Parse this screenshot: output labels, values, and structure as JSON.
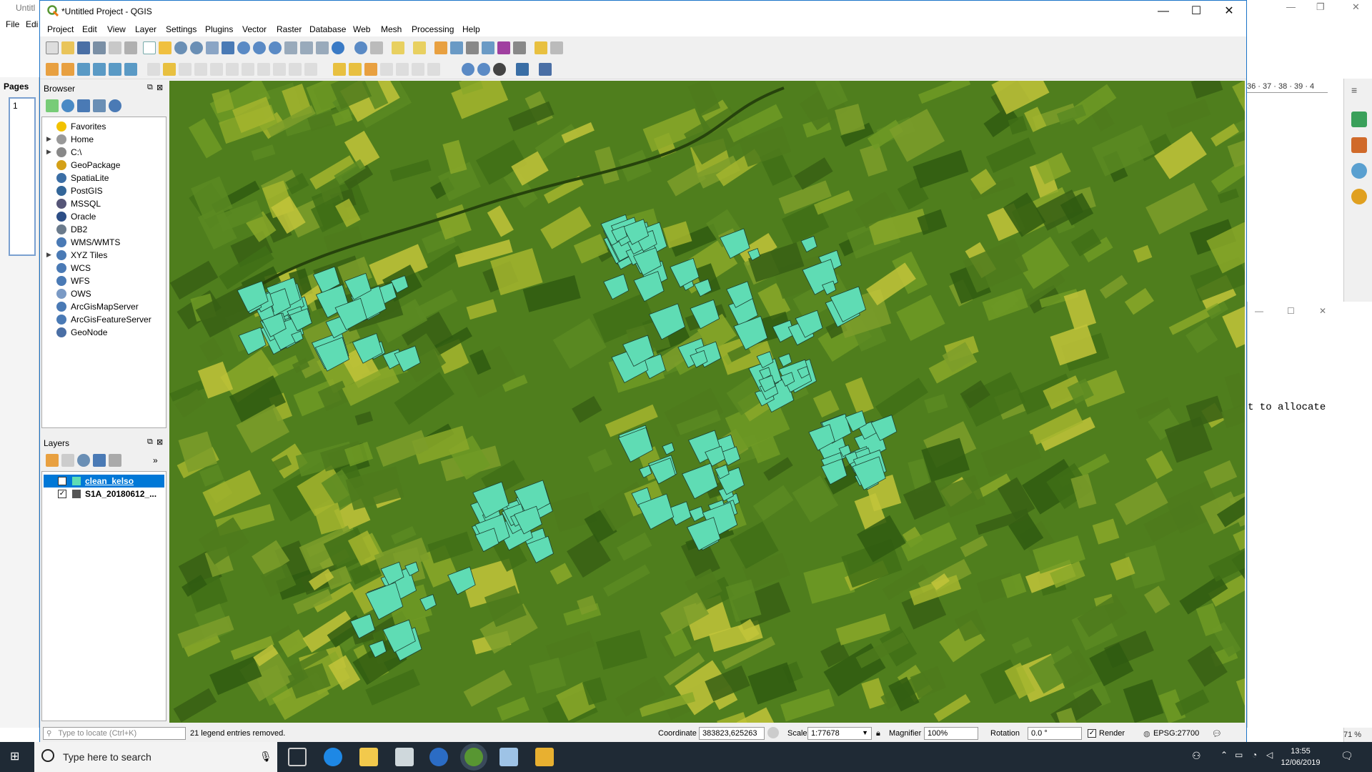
{
  "background_app": {
    "title": "Untitl",
    "menu": [
      "File",
      "Edi"
    ],
    "side_label": "Pages",
    "page_number": "1",
    "ruler": "36 · 37 · 38 · 39 · 4",
    "dialog_text": "t to allocate",
    "zoom": "71 %"
  },
  "window": {
    "title": "*Untitled Project - QGIS",
    "minimize": "—",
    "maximize": "☐",
    "close": "✕"
  },
  "menu": [
    "Project",
    "Edit",
    "View",
    "Layer",
    "Settings",
    "Plugins",
    "Vector",
    "Raster",
    "Database",
    "Web",
    "Mesh",
    "Processing",
    "Help"
  ],
  "browser": {
    "title": "Browser",
    "items": [
      {
        "label": "Favorites",
        "icon": "star-icon",
        "color": "#f2c200",
        "expand": ""
      },
      {
        "label": "Home",
        "icon": "folder-icon",
        "color": "#999999",
        "expand": "▶"
      },
      {
        "label": "C:\\",
        "icon": "drive-icon",
        "color": "#888888",
        "expand": "▶"
      },
      {
        "label": "GeoPackage",
        "icon": "geopackage-icon",
        "color": "#d4a017",
        "expand": ""
      },
      {
        "label": "SpatiaLite",
        "icon": "spatialite-icon",
        "color": "#3b6ea5",
        "expand": ""
      },
      {
        "label": "PostGIS",
        "icon": "postgis-icon",
        "color": "#336699",
        "expand": ""
      },
      {
        "label": "MSSQL",
        "icon": "mssql-icon",
        "color": "#555577",
        "expand": ""
      },
      {
        "label": "Oracle",
        "icon": "oracle-icon",
        "color": "#2d4e86",
        "expand": ""
      },
      {
        "label": "DB2",
        "icon": "db2-icon",
        "color": "#6b7b8c",
        "expand": ""
      },
      {
        "label": "WMS/WMTS",
        "icon": "wms-icon",
        "color": "#4a7ab5",
        "expand": ""
      },
      {
        "label": "XYZ Tiles",
        "icon": "xyz-icon",
        "color": "#4a7ab5",
        "expand": "▶"
      },
      {
        "label": "WCS",
        "icon": "wcs-icon",
        "color": "#4a7ab5",
        "expand": ""
      },
      {
        "label": "WFS",
        "icon": "wfs-icon",
        "color": "#4a7ab5",
        "expand": ""
      },
      {
        "label": "OWS",
        "icon": "ows-icon",
        "color": "#7a9ac5",
        "expand": ""
      },
      {
        "label": "ArcGisMapServer",
        "icon": "arcgis-map-icon",
        "color": "#4a7ab5",
        "expand": ""
      },
      {
        "label": "ArcGisFeatureServer",
        "icon": "arcgis-feature-icon",
        "color": "#4a7ab5",
        "expand": ""
      },
      {
        "label": "GeoNode",
        "icon": "geonode-icon",
        "color": "#4a6fa5",
        "expand": ""
      }
    ]
  },
  "layers": {
    "title": "Layers",
    "items": [
      {
        "name": "clean_kelso",
        "checked": "✓",
        "swatch": "#5fdcb4",
        "selected": true
      },
      {
        "name": "S1A_20180612_...",
        "checked": "✓",
        "swatch": "#555555",
        "selected": false
      }
    ]
  },
  "status": {
    "locate_placeholder": "Type to locate (Ctrl+K)",
    "message": "21 legend entries removed.",
    "coordinate_label": "Coordinate",
    "coordinate": "383823,625263",
    "scale_label": "Scale",
    "scale": "1:77678",
    "magnifier_label": "Magnifier",
    "magnifier": "100%",
    "rotation_label": "Rotation",
    "rotation": "0.0 °",
    "render_label": "Render",
    "crs": "EPSG:27700"
  },
  "taskbar": {
    "search_placeholder": "Type here to search",
    "time": "13:55",
    "date": "12/06/2019"
  },
  "colors": {
    "accent": "#1a73c8",
    "polygon_fill": "#5fdcb4",
    "map_base": "#4f7e1d"
  }
}
